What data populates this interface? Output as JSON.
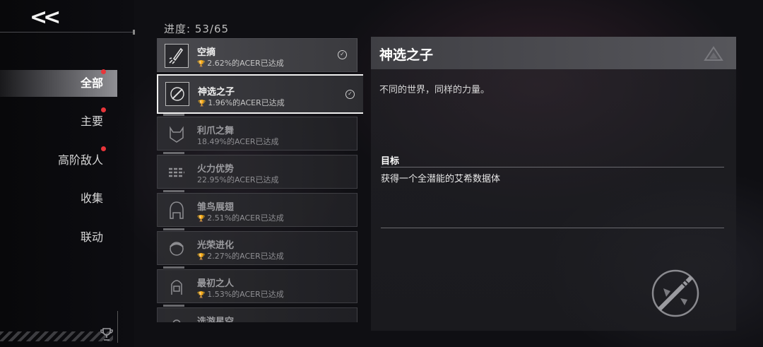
{
  "nav": {
    "back_label": "<<",
    "items": [
      {
        "label": "全部",
        "active": true,
        "badge": true
      },
      {
        "label": "主要",
        "active": false,
        "badge": true
      },
      {
        "label": "高阶敌人",
        "active": false,
        "badge": true
      },
      {
        "label": "收集",
        "active": false,
        "badge": false
      },
      {
        "label": "联动",
        "active": false,
        "badge": false
      }
    ]
  },
  "progress": {
    "label": "进度: 53/65"
  },
  "achievements": [
    {
      "name": "空摘",
      "stat": "2.62%的ACER已达成",
      "completed": true,
      "icon": "rocket-icon"
    },
    {
      "name": "神选之子",
      "stat": "1.96%的ACER已达成",
      "completed": true,
      "selected": true,
      "icon": "sword-emblem-icon"
    },
    {
      "name": "利爪之舞",
      "stat": "18.49%的ACER已达成",
      "completed": false,
      "icon": "cat-mask-icon"
    },
    {
      "name": "火力优势",
      "stat": "22.95%的ACER已达成",
      "completed": false,
      "icon": "missiles-icon"
    },
    {
      "name": "雏鸟展翅",
      "stat": "2.51%的ACER已达成",
      "completed": false,
      "icon": "hooded-figure-icon"
    },
    {
      "name": "光荣进化",
      "stat": "2.27%的ACER已达成",
      "completed": false,
      "icon": "girl-face-icon"
    },
    {
      "name": "最初之人",
      "stat": "1.53%的ACER已达成",
      "completed": false,
      "icon": "long-hair-icon"
    },
    {
      "name": "选游星空",
      "stat": "",
      "completed": false,
      "icon": "star-icon"
    }
  ],
  "detail": {
    "title": "神选之子",
    "description": "不同的世界，同样的力量。",
    "goal_label": "目标",
    "goal_text": "获得一个全潜能的艾希数据体"
  },
  "colors": {
    "badge": "#e8353a",
    "accent": "#8f8f94"
  }
}
